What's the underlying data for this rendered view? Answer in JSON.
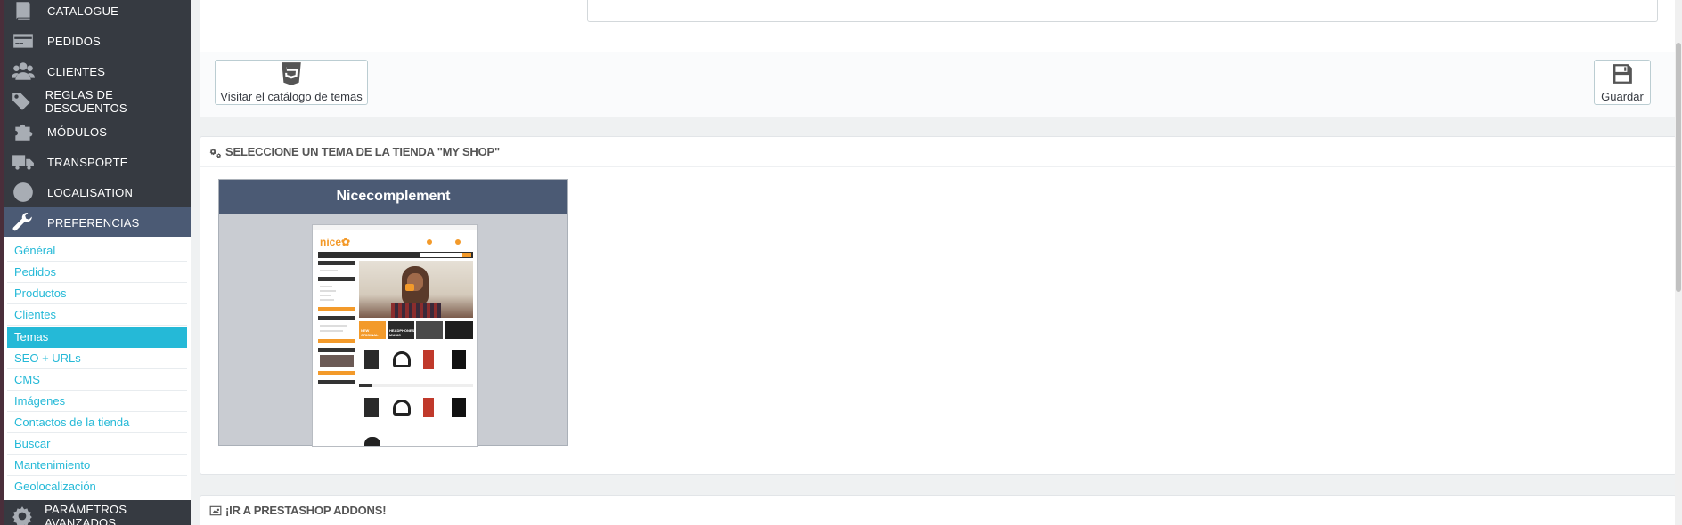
{
  "sidebar": {
    "menu": [
      {
        "label": "CATALOGUE",
        "icon": "book-icon"
      },
      {
        "label": "PEDIDOS",
        "icon": "credit-card-icon"
      },
      {
        "label": "CLIENTES",
        "icon": "users-icon"
      },
      {
        "label": "REGLAS DE DESCUENTOS",
        "icon": "tags-icon"
      },
      {
        "label": "MÓDULOS",
        "icon": "puzzle-icon"
      },
      {
        "label": "TRANSPORTE",
        "icon": "truck-icon"
      },
      {
        "label": "LOCALISATION",
        "icon": "globe-icon"
      },
      {
        "label": "PREFERENCIAS",
        "icon": "wrench-icon"
      },
      {
        "label": "PARÁMETROS AVANZADOS",
        "icon": "cogs-icon"
      }
    ],
    "active_menu": "PREFERENCIAS",
    "submenu": [
      "Général",
      "Pedidos",
      "Productos",
      "Clientes",
      "Temas",
      "SEO + URLs",
      "CMS",
      "Imágenes",
      "Contactos de la tienda",
      "Buscar",
      "Mantenimiento",
      "Geolocalización"
    ],
    "active_submenu": "Temas"
  },
  "toolbar": {
    "catalog_label": "Visitar el catálogo de temas",
    "catalog_icon": "html5-icon",
    "save_label": "Guardar",
    "save_icon": "floppy-disk-icon"
  },
  "themes_panel": {
    "heading": "SELECCIONE UN TEMA DE LA TIENDA \"MY SHOP\"",
    "heading_icon": "cogs-icon",
    "theme": {
      "name": "Nicecomplement",
      "preview": {
        "logo": "nice",
        "banner_1": "NEW ORIGINAL",
        "banner_2": "HEADPHONES MUSIC"
      }
    }
  },
  "addons_panel": {
    "heading": "¡IR A PRESTASHOP ADDONS!",
    "heading_icon": "picture-icon"
  },
  "colors": {
    "sidebar_bg": "#363a41",
    "sidebar_active": "#4b5a74",
    "accent": "#25b9d7",
    "preview_orange": "#f39a2a"
  }
}
